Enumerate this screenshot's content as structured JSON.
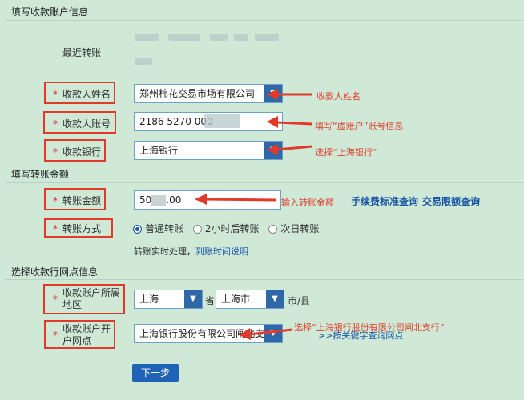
{
  "sections": {
    "account_info": "填写收款账户信息",
    "amount_info": "填写转账金额",
    "branch_info": "选择收款行网点信息"
  },
  "recent_label": "最近转账",
  "form": {
    "payee_name": {
      "label": "收款人姓名",
      "value": "郑州棉花交易市场有限公司"
    },
    "payee_account": {
      "label": "收款人账号",
      "value": "2186 5270 000"
    },
    "payee_bank": {
      "label": "收款银行",
      "value": "上海银行"
    },
    "amount": {
      "label": "转账金额",
      "value_prefix": "50",
      "value_suffix": ".00"
    },
    "method": {
      "label": "转账方式",
      "options": [
        "普通转账",
        "2小时后转账",
        "次日转账"
      ],
      "selected": "普通转账"
    },
    "method_note": "转账实时处理，",
    "method_note_link": "到账时间说明",
    "region": {
      "label": "收款账户所属地区",
      "province": "上海",
      "province_unit": "省",
      "city": "上海市",
      "city_unit": "市/县"
    },
    "branch": {
      "label": "收款账户开户网点",
      "value": "上海银行股份有限公司闸北支"
    }
  },
  "links": {
    "fee_standard": "手续费标准查询",
    "limit_query": "交易限额查询",
    "keyword_search": ">>按关键字查询网点"
  },
  "annotations": {
    "payee_name": "收款人姓名",
    "payee_account": "填写“虚账户”账号信息",
    "payee_bank": "选择“上海银行”",
    "amount": "输入转账金额",
    "branch": "选择“上海银行股份有限公司闸北支行”"
  },
  "next_button": "下一步",
  "colors": {
    "background": "#cfe9d6",
    "accent": "#1f63b6",
    "annotation": "#e23a2a"
  }
}
